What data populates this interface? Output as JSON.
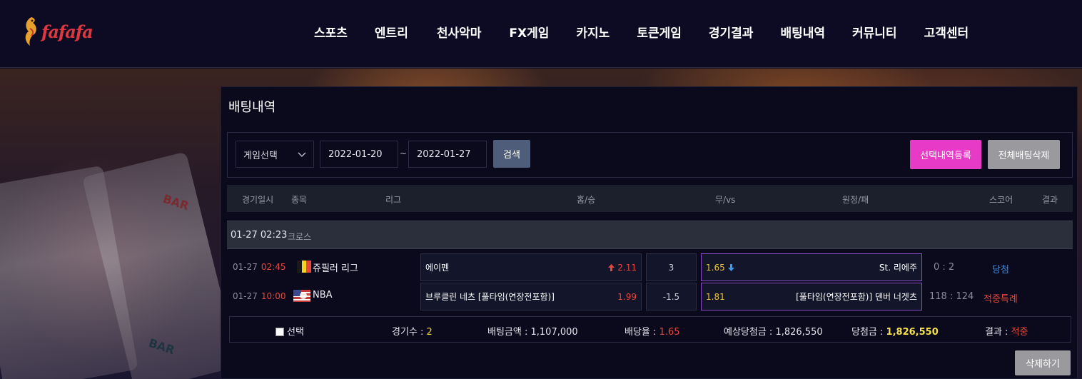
{
  "header": {
    "logo_text": "fafafa",
    "nav": [
      "스포츠",
      "엔트리",
      "천사악마",
      "FX게임",
      "카지노",
      "토큰게임",
      "경기결과",
      "배팅내역",
      "커뮤니티",
      "고객센터"
    ]
  },
  "background": {
    "reel_labels": [
      "BAR",
      "BAR"
    ]
  },
  "panel": {
    "title": "배팅내역",
    "filter": {
      "game_select": "게임선택",
      "date_from": "2022-01-20",
      "date_sep": "~",
      "date_to": "2022-01-27",
      "search_label": "검색",
      "register_label": "선택내역등록",
      "delete_all_label": "전체배팅삭제"
    },
    "table_headers": [
      "경기일시",
      "종목",
      "리그",
      "홈/승",
      "무/vs",
      "원정/패",
      "스코어",
      "결과"
    ],
    "group": {
      "time": "01-27 02:23",
      "type": "크로스"
    },
    "rows": [
      {
        "date": "01-27",
        "time": "02:45",
        "flag": "belgium-flag",
        "league": "쥬필러 리그",
        "home": "에이펜",
        "home_odd": "2.11",
        "home_indicator": "up-arrow",
        "mid": "3",
        "away_odd": "1.65",
        "away_indicator": "down-arrow",
        "away": "St. 리에주",
        "score": "0 : 2",
        "result": "당첨",
        "result_color": "#3b8be8"
      },
      {
        "date": "01-27",
        "time": "10:00",
        "flag": "usa-flag",
        "league": "NBA",
        "home": "브루클린 네츠 [풀타임(연장전포함)]",
        "home_odd": "1.99",
        "mid": "-1.5",
        "away_odd": "1.81",
        "away": "[풀타임(연장전포함)] 덴버 너겟츠",
        "score": "118 : 124",
        "result": "적중특례",
        "result_color": "#e8463b"
      }
    ],
    "summary": {
      "select_label": "선택",
      "games_label": "경기수 :",
      "games_value": "2",
      "bet_amount_label": "배팅금액 :",
      "bet_amount_value": "1,107,000",
      "odds_label": "배당율 :",
      "odds_value": "1.65",
      "expected_label": "예상당첨금 :",
      "expected_value": "1,826,550",
      "won_label": "당첨금 :",
      "won_value": "1,826,550",
      "result_label": "결과 :",
      "result_value": "적중"
    },
    "delete_label": "삭제하기"
  },
  "colors": {
    "accent_pink": "#e63ac7",
    "win_blue": "#3b8be8",
    "red": "#e8463b",
    "yellow": "#e8d23b"
  }
}
